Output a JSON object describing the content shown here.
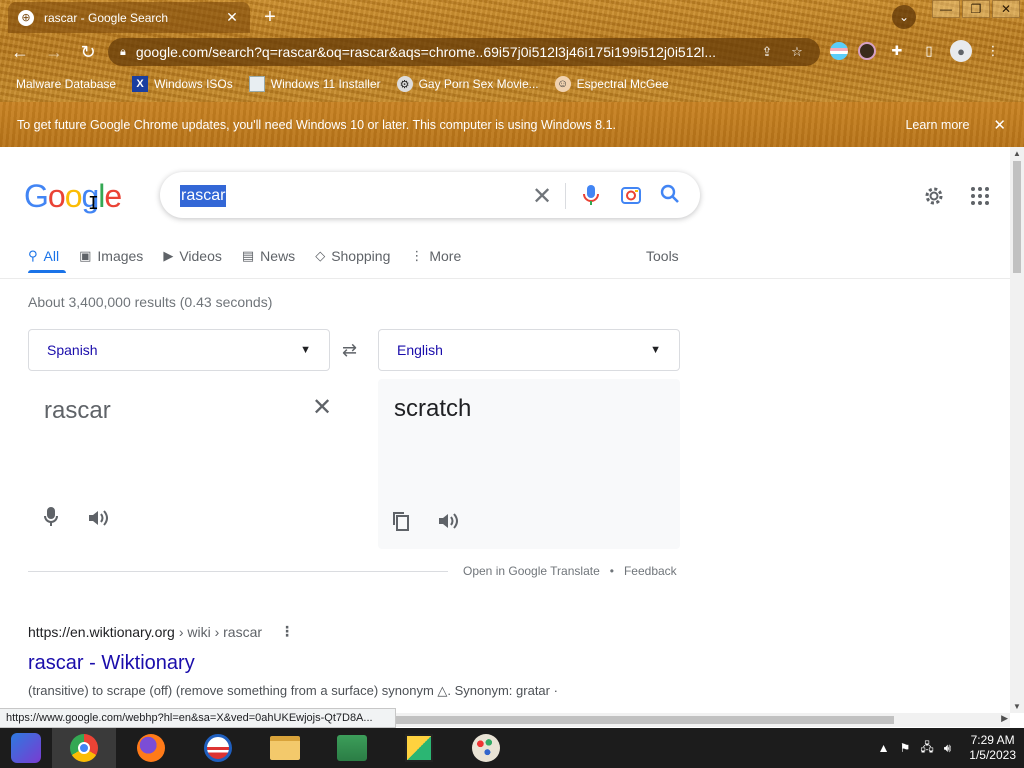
{
  "browser": {
    "tab_title": "rascar - Google Search",
    "url": "google.com/search?q=rascar&oq=rascar&aqs=chrome..69i57j0i512l3j46i175i199i512j0i512l...",
    "bookmarks": [
      "Malware Database",
      "Windows ISOs",
      "Windows 11 Installer",
      "Gay Porn Sex Movie...",
      "Espectral McGee"
    ],
    "infobar": {
      "message": "To get future Google Chrome updates, you'll need Windows 10 or later. This computer is using Windows 8.1.",
      "learn_more": "Learn more"
    },
    "status_url": "https://www.google.com/webhp?hl=en&sa=X&ved=0ahUKEwjojs-Qt7D8A..."
  },
  "google": {
    "logo_letters": [
      "G",
      "o",
      "o",
      "g",
      "l",
      "e"
    ],
    "query": "rascar",
    "tabs": [
      {
        "label": "All",
        "icon": "search-icon"
      },
      {
        "label": "Images",
        "icon": "image-icon"
      },
      {
        "label": "Videos",
        "icon": "play-icon"
      },
      {
        "label": "News",
        "icon": "newspaper-icon"
      },
      {
        "label": "Shopping",
        "icon": "tag-icon"
      },
      {
        "label": "More",
        "icon": "more-vert-icon"
      }
    ],
    "tools": "Tools",
    "stats": "About 3,400,000 results (0.43 seconds)"
  },
  "translate": {
    "source_lang": "Spanish",
    "target_lang": "English",
    "source_text": "rascar",
    "target_text": "scratch",
    "open_link": "Open in Google Translate",
    "separator": "•",
    "feedback": "Feedback"
  },
  "result": {
    "site": "https://en.wiktionary.org",
    "breadcrumbs": "› wiki › rascar",
    "title": "rascar - Wiktionary",
    "snippet": "(transitive) to scrape (off) (remove something from a surface) synonym △. Synonym: gratar ·"
  },
  "taskbar": {
    "time": "7:29 AM",
    "date": "1/5/2023"
  },
  "colors": {
    "link": "#1a0dab",
    "accent": "#1a73e8",
    "chrome_frame": "#c48728"
  }
}
